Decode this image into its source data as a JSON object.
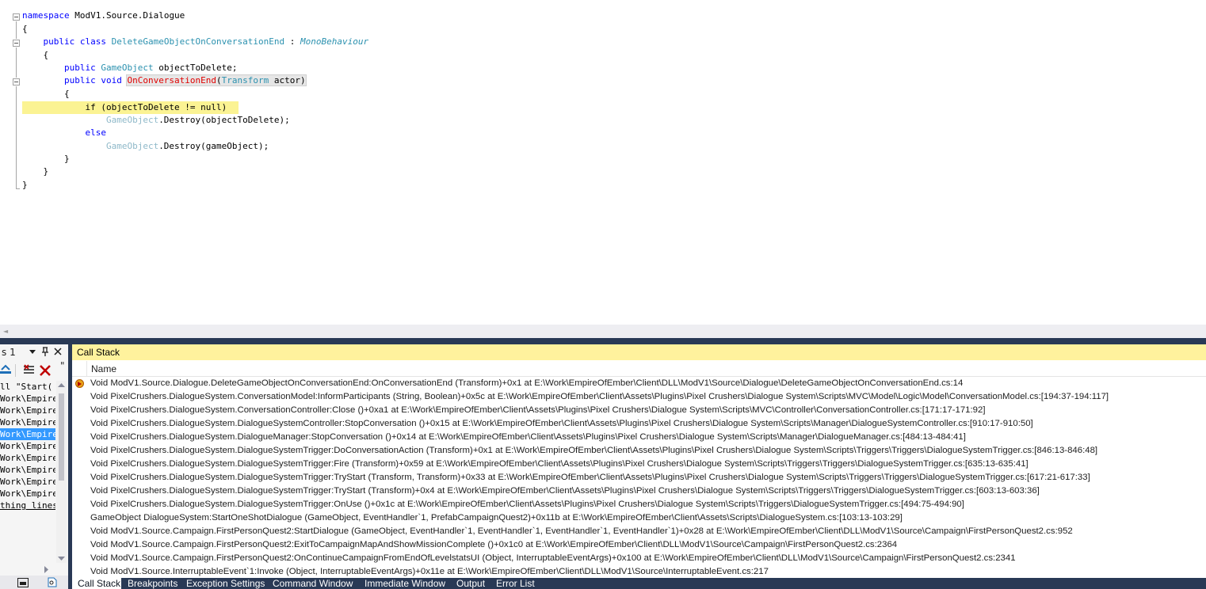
{
  "editor": {
    "lines": {
      "l1_kw": "namespace",
      "l1_ns": " ModV1.Source.Dialogue",
      "l2": "{",
      "l3_kw": "    public class ",
      "l3_ty": "DeleteGameObjectOnConversationEnd",
      "l3_sep": " : ",
      "l3_base": "MonoBehaviour",
      "l4": "    {",
      "l5_kw": "        public ",
      "l5_ty": "GameObject",
      "l5_rest": " objectToDelete;",
      "l6_kw": "        public void ",
      "l6_fn": "OnConversationEnd",
      "l6_p1": "(",
      "l6_ty": "Transform",
      "l6_p2": " actor)",
      "l7": "        {",
      "l8": "            if (objectToDelete != null)",
      "l9_ty": "                GameObject",
      "l9_rest": ".Destroy(objectToDelete);",
      "l10_kw": "            else",
      "l11_ty": "                GameObject",
      "l11_rest": ".Destroy(gameObject);",
      "l12": "        }",
      "l13": "    }",
      "l14": "}"
    }
  },
  "left_panel": {
    "title": "s 1",
    "rows": [
      "ll \"Start(",
      "Work\\Empire",
      "Work\\Empire",
      "Work\\Empire",
      "Work\\Empire",
      "Work\\Empire",
      "Work\\Empire",
      "Work\\Empire",
      "Work\\Empire",
      "Work\\Empire",
      "thing lines"
    ]
  },
  "call_stack": {
    "title": "Call Stack",
    "column_name": "Name",
    "rows": [
      "Void ModV1.Source.Dialogue.DeleteGameObjectOnConversationEnd:OnConversationEnd (Transform)+0x1 at E:\\Work\\EmpireOfEmber\\Client\\DLL\\ModV1\\Source\\Dialogue\\DeleteGameObjectOnConversationEnd.cs:14",
      "Void PixelCrushers.DialogueSystem.ConversationModel:InformParticipants (String, Boolean)+0x5c at E:\\Work\\EmpireOfEmber\\Client\\Assets\\Plugins\\Pixel Crushers\\Dialogue System\\Scripts\\MVC\\Model\\Logic\\Model\\ConversationModel.cs:[194:37-194:117]",
      "Void PixelCrushers.DialogueSystem.ConversationController:Close ()+0xa1 at E:\\Work\\EmpireOfEmber\\Client\\Assets\\Plugins\\Pixel Crushers\\Dialogue System\\Scripts\\MVC\\Controller\\ConversationController.cs:[171:17-171:92]",
      "Void PixelCrushers.DialogueSystem.DialogueSystemController:StopConversation ()+0x15 at E:\\Work\\EmpireOfEmber\\Client\\Assets\\Plugins\\Pixel Crushers\\Dialogue System\\Scripts\\Manager\\DialogueSystemController.cs:[910:17-910:50]",
      "Void PixelCrushers.DialogueSystem.DialogueManager:StopConversation ()+0x14 at E:\\Work\\EmpireOfEmber\\Client\\Assets\\Plugins\\Pixel Crushers\\Dialogue System\\Scripts\\Manager\\DialogueManager.cs:[484:13-484:41]",
      "Void PixelCrushers.DialogueSystem.DialogueSystemTrigger:DoConversationAction (Transform)+0x1 at E:\\Work\\EmpireOfEmber\\Client\\Assets\\Plugins\\Pixel Crushers\\Dialogue System\\Scripts\\Triggers\\Triggers\\DialogueSystemTrigger.cs:[846:13-846:48]",
      "Void PixelCrushers.DialogueSystem.DialogueSystemTrigger:Fire (Transform)+0x59 at E:\\Work\\EmpireOfEmber\\Client\\Assets\\Plugins\\Pixel Crushers\\Dialogue System\\Scripts\\Triggers\\Triggers\\DialogueSystemTrigger.cs:[635:13-635:41]",
      "Void PixelCrushers.DialogueSystem.DialogueSystemTrigger:TryStart (Transform, Transform)+0x33 at E:\\Work\\EmpireOfEmber\\Client\\Assets\\Plugins\\Pixel Crushers\\Dialogue System\\Scripts\\Triggers\\Triggers\\DialogueSystemTrigger.cs:[617:21-617:33]",
      "Void PixelCrushers.DialogueSystem.DialogueSystemTrigger:TryStart (Transform)+0x4 at E:\\Work\\EmpireOfEmber\\Client\\Assets\\Plugins\\Pixel Crushers\\Dialogue System\\Scripts\\Triggers\\Triggers\\DialogueSystemTrigger.cs:[603:13-603:36]",
      "Void PixelCrushers.DialogueSystem.DialogueSystemTrigger:OnUse ()+0x1c at E:\\Work\\EmpireOfEmber\\Client\\Assets\\Plugins\\Pixel Crushers\\Dialogue System\\Scripts\\Triggers\\DialogueSystemTrigger.cs:[494:75-494:90]",
      "GameObject DialogueSystem:StartOneShotDialogue (GameObject, EventHandler`1, PrefabCampaignQuest2)+0x11b at E:\\Work\\EmpireOfEmber\\Client\\Assets\\Scripts\\DialogueSystem.cs:[103:13-103:29]",
      "Void ModV1.Source.Campaign.FirstPersonQuest2:StartDialogue (GameObject, EventHandler`1, EventHandler`1, EventHandler`1, EventHandler`1)+0x28 at E:\\Work\\EmpireOfEmber\\Client\\DLL\\ModV1\\Source\\Campaign\\FirstPersonQuest2.cs:952",
      "Void ModV1.Source.Campaign.FirstPersonQuest2:ExitToCampaignMapAndShowMissionComplete ()+0x1c0 at E:\\Work\\EmpireOfEmber\\Client\\DLL\\ModV1\\Source\\Campaign\\FirstPersonQuest2.cs:2364",
      "Void ModV1.Source.Campaign.FirstPersonQuest2:OnContinueCampaignFromEndOfLevelstatsUI (Object, InterruptableEventArgs)+0x100 at E:\\Work\\EmpireOfEmber\\Client\\DLL\\ModV1\\Source\\Campaign\\FirstPersonQuest2.cs:2341",
      "Void ModV1.Source.InterruptableEvent`1:Invoke (Object, InterruptableEventArgs)+0x11e at E:\\Work\\EmpireOfEmber\\Client\\DLL\\ModV1\\Source\\InterruptableEvent.cs:217"
    ]
  },
  "tabs": [
    "Call Stack",
    "Breakpoints",
    "Exception Settings",
    "Command Window",
    "Immediate Window",
    "Output",
    "Error List"
  ],
  "colors": {
    "current_line_highlight": "#fbf393",
    "tool_window_title_active": "#fff29d",
    "dock_background": "#293955",
    "keyword": "#0000ff",
    "type": "#2b91af",
    "method": "#74531f",
    "selection": "#3399ff"
  }
}
